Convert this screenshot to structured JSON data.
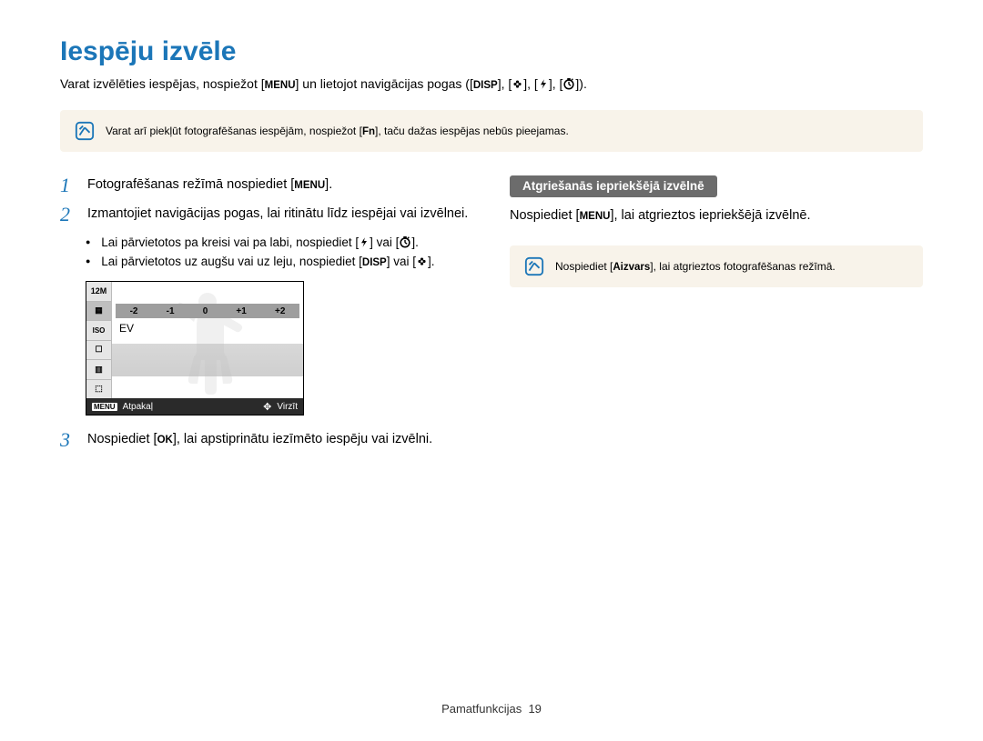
{
  "title": "Iespēju izvēle",
  "intro": {
    "part1": "Varat izvēlēties iespējas, nospiežot [",
    "btn_menu": "MENU",
    "part2": "] un lietojot navigācijas pogas ([",
    "btn_disp": "DISP",
    "closing": "]).",
    "sep": "], ["
  },
  "note1": {
    "part1": "Varat arī piekļūt fotografēšanas iespējām, nospiežot [",
    "btn_fn": "Fn",
    "part2": "], taču dažas iespējas nebūs pieejamas."
  },
  "step1": {
    "num": "1",
    "t1": "Fotografēšanas režīmā nospiediet [",
    "btn_menu": "MENU",
    "t2": "]."
  },
  "step2": {
    "num": "2",
    "text": "Izmantojiet navigācijas pogas, lai ritinātu līdz iespējai vai izvēlnei."
  },
  "bullet1": {
    "a": "Lai pārvietotos pa kreisi vai pa labi, nospiediet [",
    "b": "] vai [",
    "c": "]."
  },
  "bullet2": {
    "a": "Lai pārvietotos uz augšu vai uz leju, nospiediet [",
    "btn_disp": "DISP",
    "b": "] vai [",
    "c": "]."
  },
  "camera": {
    "side": [
      "12M",
      "▦",
      "ISO",
      "☐",
      "▥",
      "⬚"
    ],
    "ev_ticks": [
      "-2",
      "-1",
      "0",
      "+1",
      "+2"
    ],
    "ev_label": "EV",
    "bottom_menu": "MENU",
    "bottom_back": "Atpakaļ",
    "bottom_move": "Virzīt"
  },
  "step3": {
    "num": "3",
    "t1": "Nospiediet [",
    "btn_ok": "OK",
    "t2": "], lai apstiprinātu iezīmēto iespēju vai izvēlni."
  },
  "right": {
    "subhead": "Atgriešanās iepriekšējā izvēlnē",
    "t1": "Nospiediet [",
    "btn_menu": "MENU",
    "t2": "], lai atgrieztos iepriekšējā izvēlnē."
  },
  "note2": {
    "t1": "Nospiediet [",
    "btn_shutter": "Aizvars",
    "t2": "], lai atgrieztos fotografēšanas režīmā."
  },
  "footer": {
    "section": "Pamatfunkcijas",
    "page": "19"
  }
}
